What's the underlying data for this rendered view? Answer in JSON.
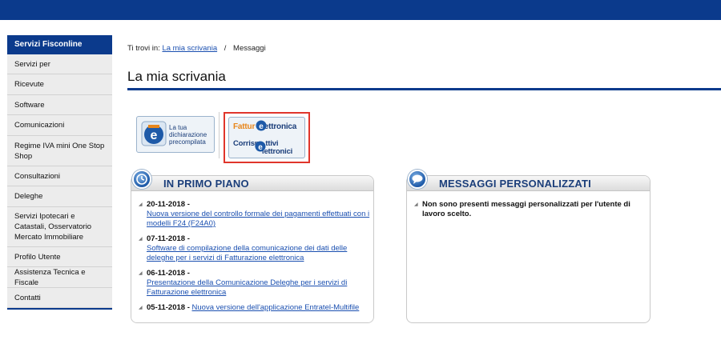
{
  "sidebar": {
    "header": "Servizi Fisconline",
    "items": [
      {
        "label": "Servizi per",
        "h": 25
      },
      {
        "label": "Ricevute",
        "h": 26
      },
      {
        "label": "Software",
        "h": 25
      },
      {
        "label": "Comunicazioni",
        "h": 26
      },
      {
        "label": "Regime IVA mini One Stop Shop",
        "h": 38
      },
      {
        "label": "Consultazioni",
        "h": 25
      },
      {
        "label": "Deleghe",
        "h": 26
      },
      {
        "label": "Servizi Ipotecari e Catastali, Osservatorio Mercato Immobiliare",
        "h": 50
      },
      {
        "label": "Profilo Utente",
        "h": 25
      },
      {
        "label": "Assistenza Tecnica e Fiscale",
        "h": 26
      },
      {
        "label": "Contatti",
        "h": 25
      }
    ]
  },
  "breadcrumb": {
    "prefix": "Ti trovi in:",
    "link": "La mia scrivania",
    "separator": "/",
    "current": "Messaggi"
  },
  "page_title": "La mia scrivania",
  "banners": {
    "precompilata": "La tua dichiarazione precompilata",
    "fattura_prefix": "Fattur",
    "fattura_suffix": "lettronica",
    "corrispettivi_a": "Corrisp",
    "corrispettivi_b": "ttivi",
    "corrispettivi_c": "lettronici"
  },
  "primo_piano": {
    "title": "IN PRIMO PIANO",
    "news": [
      {
        "date": "20-11-2018 -",
        "text": "Nuova versione del controllo formale dei pagamenti effettuati con i modelli F24 (F24A0)"
      },
      {
        "date": "07-11-2018 -",
        "text": "Software di compilazione della comunicazione dei dati delle deleghe per i servizi di Fatturazione elettronica"
      },
      {
        "date": "06-11-2018 -",
        "text": "Presentazione della Comunicazione Deleghe per i servizi di Fatturazione elettronica"
      },
      {
        "date": "05-11-2018 -",
        "text": "Nuova versione dell'applicazione Entratel-Multifile"
      }
    ]
  },
  "messaggi": {
    "title": "MESSAGGI PERSONALIZZATI",
    "text": "Non sono presenti messaggi personalizzati per l'utente di lavoro scelto."
  },
  "colors": {
    "brand_blue": "#0b3a8c",
    "link": "#1a4fb0",
    "highlight_border": "#e0352b"
  }
}
